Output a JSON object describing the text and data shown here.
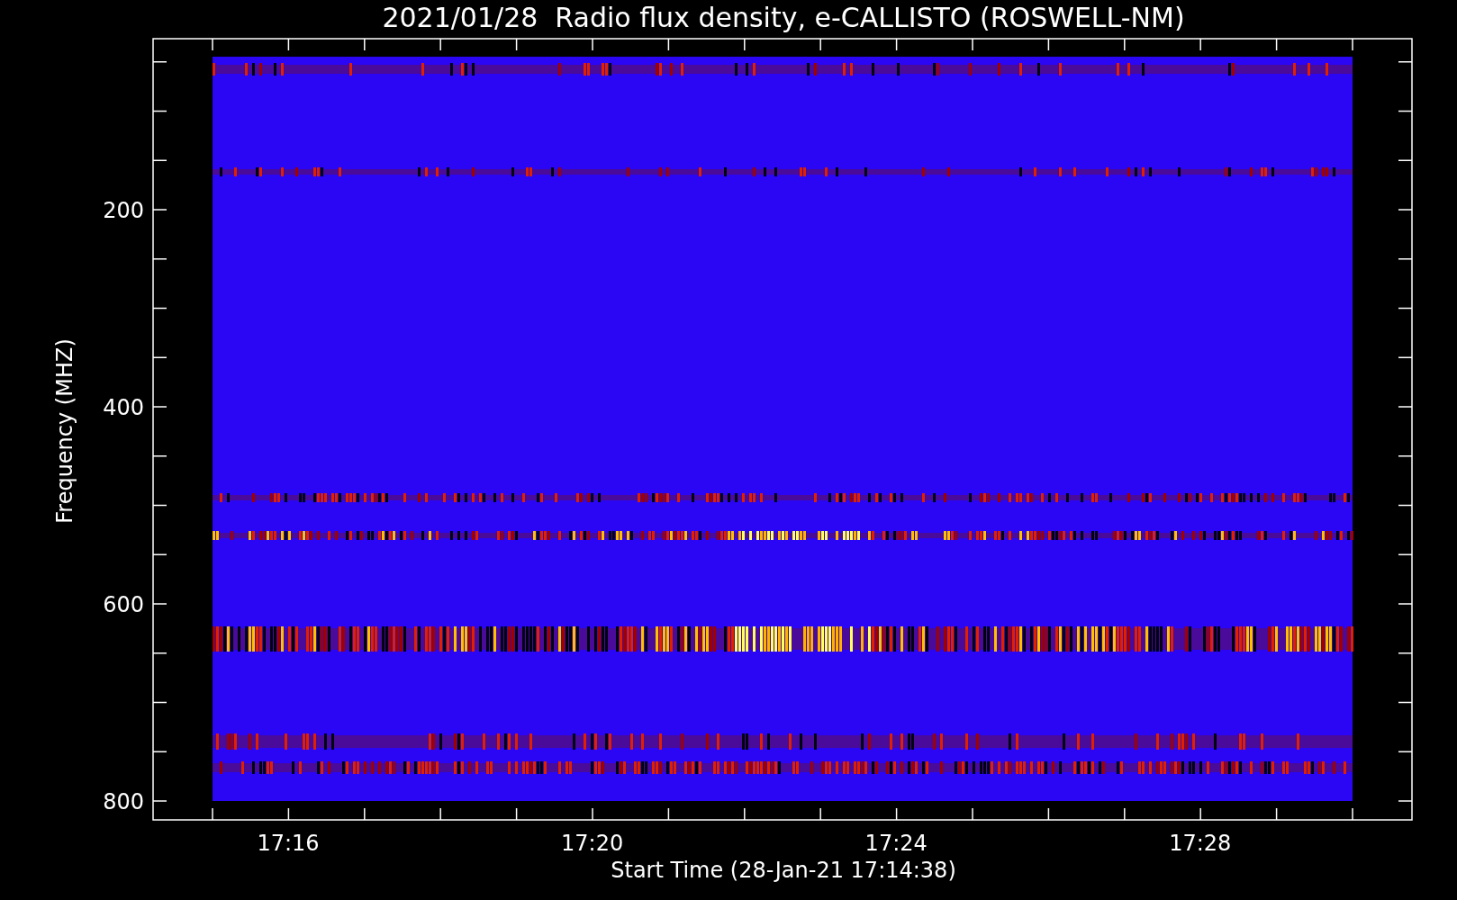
{
  "title": "2021/01/28  Radio flux density, e-CALLISTO (ROSWELL-NM)",
  "y_axis": {
    "label": "Frequency (MHZ)",
    "tick_labels": [
      "200",
      "400",
      "600",
      "800"
    ]
  },
  "x_axis": {
    "label": "Start Time (28-Jan-21 17:14:38)",
    "tick_labels": [
      "17:16",
      "17:20",
      "17:24",
      "17:28"
    ]
  }
}
